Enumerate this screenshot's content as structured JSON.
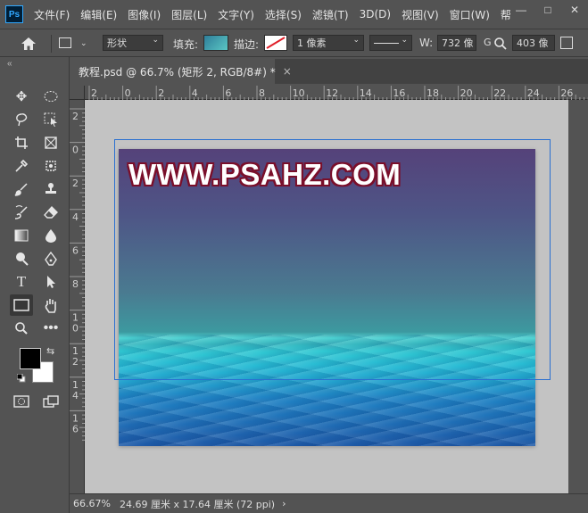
{
  "app": {
    "logo_text": "Ps"
  },
  "menu": {
    "items": [
      "文件(F)",
      "编辑(E)",
      "图像(I)",
      "图层(L)",
      "文字(Y)",
      "选择(S)",
      "滤镜(T)",
      "3D(D)",
      "视图(V)",
      "窗口(W)",
      "帮"
    ]
  },
  "window_controls": {
    "minimize": "—",
    "maximize": "□",
    "close": "✕"
  },
  "options": {
    "home_icon": "home-icon",
    "shape_mode": "形状",
    "fill_label": "填充:",
    "fill_color": "#3fb5b5",
    "stroke_label": "描边:",
    "stroke_width": "1 像素",
    "w_label": "W:",
    "w_value": "732 像",
    "g_label": "G",
    "h_value": "403 像"
  },
  "document_tab": {
    "title": "教程.psd @ 66.7% (矩形 2, RGB/8#) *",
    "close": "×"
  },
  "ruler": {
    "h_labels": [
      "2",
      "0",
      "2",
      "4",
      "6",
      "8",
      "10",
      "12",
      "14",
      "16",
      "18",
      "20",
      "22",
      "24",
      "26"
    ],
    "v_labels": [
      "2",
      "0",
      "2",
      "4",
      "6",
      "8",
      "1\n0",
      "1\n2",
      "1\n4",
      "1\n6"
    ]
  },
  "canvas": {
    "watermark_text": "WWW.PSAHZ.COM"
  },
  "status": {
    "zoom": "66.67%",
    "doc_info": "24.69 厘米 x 17.64 厘米 (72 ppi)",
    "arrow": "›"
  },
  "colors": {
    "foreground": "#000000",
    "background": "#ffffff",
    "selection_stroke": "#2a6fd0"
  }
}
